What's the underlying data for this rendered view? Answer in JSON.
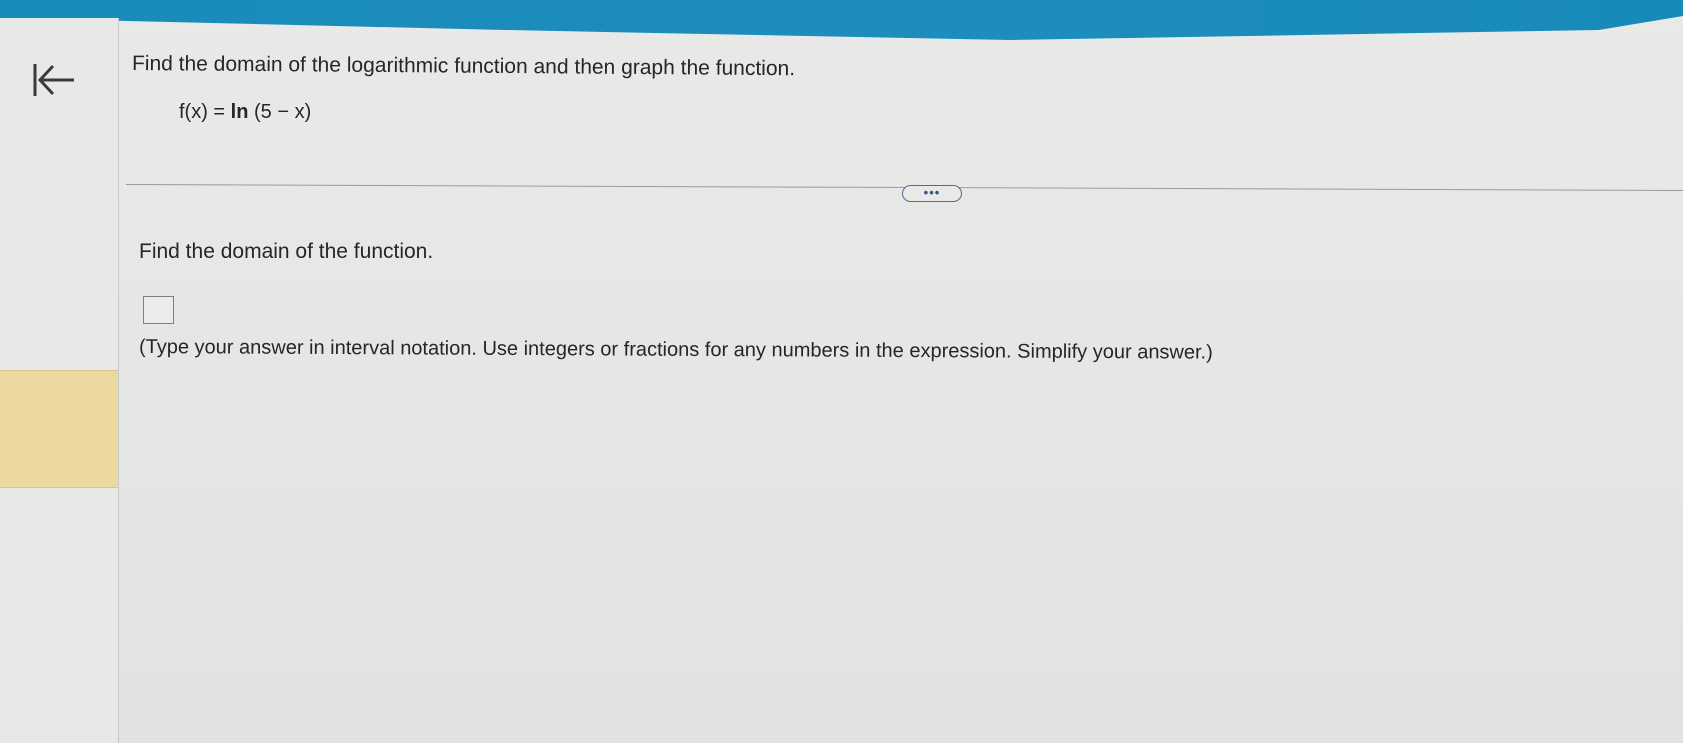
{
  "colors": {
    "top_bar": "#1a8cbc",
    "rail_highlight": "#ecd9a0",
    "more_button_border": "#4a6d95"
  },
  "nav": {
    "back_icon": "arrow-left-to-bar-icon"
  },
  "question": {
    "title": "Find the domain of the logarithmic function and then graph the function.",
    "formula_prefix": "f(x) = ",
    "formula_ln": "ln",
    "formula_suffix": " (5 − x)"
  },
  "more_button": {
    "label": "•••"
  },
  "part": {
    "prompt": "Find the domain of the function.",
    "answer_value": "",
    "hint": "(Type your answer in interval notation. Use integers or fractions for any numbers in the expression. Simplify your answer.)"
  }
}
